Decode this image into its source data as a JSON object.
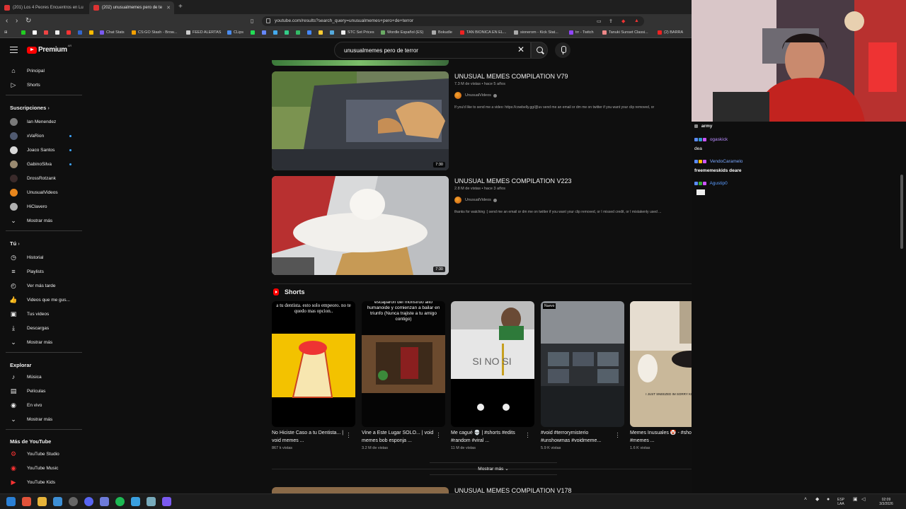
{
  "browser": {
    "tabs": [
      {
        "label": "(201) Los 4 Peores Encuentros en Lu"
      },
      {
        "label": "(202) unusualmemes pero de te"
      }
    ],
    "new_tab": "+",
    "url": "youtube.com/results?search_query=unusualmemes+pero+de+terror",
    "bookmarks": [
      "Chat Stats",
      "CS:GO Stash - Brow...",
      "FEED ALERTAS",
      "CLips",
      "STC Set Prices",
      "Wordle Español (ES)",
      "Bokudle",
      "TAN BIONICA EN EL...",
      "sionerom - Kick Stat...",
      "trr - Twitch",
      "Tanuki Sunset Classi...",
      "(2) BARRA"
    ]
  },
  "youtube": {
    "logo_text": "Premium",
    "logo_country": "AR",
    "search_value": "unusualmemes pero de terror",
    "sidebar": {
      "main": [
        {
          "label": "Principal",
          "icon": "home-icon"
        },
        {
          "label": "Shorts",
          "icon": "shorts-icon"
        }
      ],
      "subs_heading": "Suscripciones",
      "subs": [
        {
          "label": "Ian Menendez",
          "color": "#7a7a7a",
          "live": false
        },
        {
          "label": "xVaRion",
          "color": "#505a70",
          "live": true
        },
        {
          "label": "Joaco Santos",
          "color": "#d8d8d8",
          "live": true
        },
        {
          "label": "GabinoSilva",
          "color": "#9a8a70",
          "live": true
        },
        {
          "label": "DrossRotzank",
          "color": "#3a2a2a",
          "live": false
        },
        {
          "label": "UnusualVideos",
          "color": "#e8861c",
          "live": false
        },
        {
          "label": "HiClavero",
          "color": "#b0b0b0",
          "live": false
        },
        {
          "label": "Mostrar más",
          "color": "",
          "live": false
        }
      ],
      "you_heading": "Tú",
      "you": [
        {
          "label": "Historial",
          "icon": "history-icon"
        },
        {
          "label": "Playlists",
          "icon": "playlists-icon"
        },
        {
          "label": "Ver más tarde",
          "icon": "watch-later-icon"
        },
        {
          "label": "Videos que me gus...",
          "icon": "liked-icon"
        },
        {
          "label": "Tus videos",
          "icon": "your-videos-icon"
        },
        {
          "label": "Descargas",
          "icon": "downloads-icon"
        },
        {
          "label": "Mostrar más",
          "icon": "chevron-down-icon"
        }
      ],
      "explore_heading": "Explorar",
      "explore": [
        {
          "label": "Música",
          "icon": "music-icon"
        },
        {
          "label": "Películas",
          "icon": "movies-icon"
        },
        {
          "label": "En vivo",
          "icon": "live-icon"
        },
        {
          "label": "Mostrar más",
          "icon": "chevron-down-icon"
        }
      ],
      "more_heading": "Más de YouTube",
      "more": [
        {
          "label": "YouTube Studio"
        },
        {
          "label": "YouTube Music"
        },
        {
          "label": "YouTube Kids"
        }
      ]
    },
    "videos": [
      {
        "title": "UNUSUAL MEMES COMPILATION V79",
        "meta": "7.3 M de vistas • hace 5 años",
        "channel": "UnusualVideos",
        "description": "If you'd like to send me a video: https://cowbelly.gg/@uv send me an email or dm me on twitter if you want your clip removed, or",
        "duration": "7:30"
      },
      {
        "title": "UNUSUAL MEMES COMPILATION V223",
        "meta": "2.8 M de vistas • hace 3 años",
        "channel": "UnusualVideos",
        "description": "thanks for watching :) send me an email or dm me on twitter if you want your clip removed, or I missed credit, or I mistakenly used ...",
        "duration": "7:30"
      }
    ],
    "shorts_heading": "Shorts",
    "shorts": [
      {
        "title": "No Hiciste Caso a tu Dentista... | void memes ...",
        "views": "867 k vistas",
        "caption": "a tu dentista. esto solo empeoro. no te quedo mas opcion.."
      },
      {
        "title": "Vine a Este Lugar SOLO... | void memes bob esponja ...",
        "views": "3.2 M de vistas",
        "caption": "escaparon del monstruo alto humanoide y comienzan a bailar en triunfo (Nunca trajiste a tu amigo contigo)"
      },
      {
        "title": "Me cagué 💀 | #shorts #edits #random #viral ...",
        "views": "11 M de vistas",
        "caption": "SI NO SI"
      },
      {
        "title": "#void #terrorymisterio #unshowmas #voidmeme...",
        "views": "5.9 K vistas",
        "caption": "Nuevo"
      },
      {
        "title": "Memes Inusuales 🤡 - #shorts #memes ...",
        "views": "1.6 K vistas",
        "caption": "I JUST SNEEZED IM SORRY KITTY"
      }
    ],
    "show_more": "Mostrar más",
    "next_title": "UNUSUAL MEMES COMPILATION V178"
  },
  "chat": {
    "messages": [
      {
        "user": "army",
        "color": "#e8e8e8",
        "text": ""
      },
      {
        "user": "ogaskick",
        "color": "#b88cff",
        "text": ""
      },
      {
        "user": "",
        "color": "#ffffff",
        "text": "dea"
      },
      {
        "user": "VendoCaramelo",
        "color": "#7aa8ff",
        "text": ""
      },
      {
        "user": "",
        "color": "#ffffff",
        "text": "freememeskids deare"
      },
      {
        "user": "Agustip0",
        "color": "#5a9cff",
        "text": ""
      }
    ]
  },
  "taskbar": {
    "lang": "ESP",
    "lang2": "LAA",
    "time": "02:09",
    "date": "3/3/2026"
  }
}
